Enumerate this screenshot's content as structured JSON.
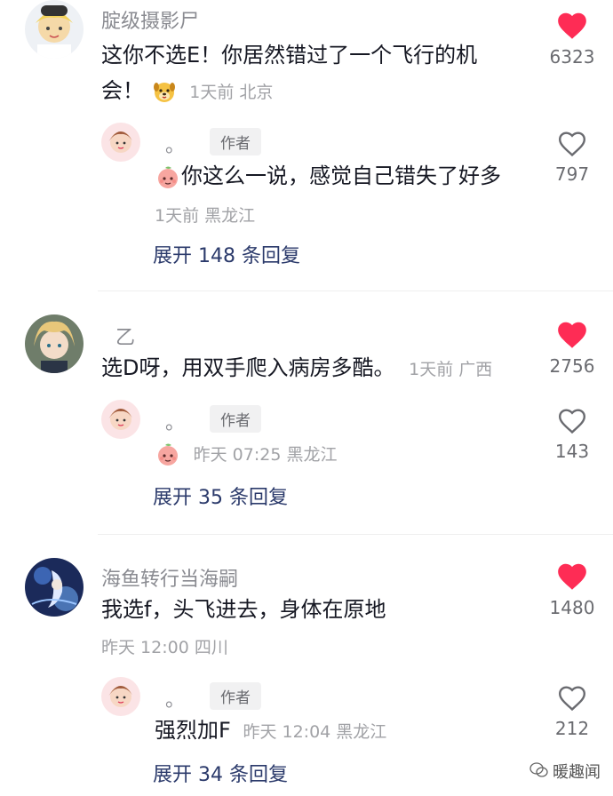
{
  "colors": {
    "like_red": "#fe2c55",
    "expand_blue": "#2b3a6b"
  },
  "comments": [
    {
      "username": "腚级摄影尸",
      "text_line1": "这你不选E！你居然错过了一个飞行的机",
      "text_line2": "会！",
      "meta": "1天前 北京",
      "likes": "6323",
      "liked": true,
      "reply": {
        "name": "。",
        "badge": "作者",
        "text": "你这么一说，感觉自己错失了好多",
        "meta": "1天前 黑龙江",
        "likes": "797",
        "liked": false
      },
      "expand": "展开 148 条回复"
    },
    {
      "username": "乙",
      "text": "选D呀，用双手爬入病房多酷。",
      "meta": "1天前 广西",
      "likes": "2756",
      "liked": true,
      "reply": {
        "name": "。",
        "badge": "作者",
        "meta": "昨天 07:25 黑龙江",
        "likes": "143",
        "liked": false
      },
      "expand": "展开 35 条回复"
    },
    {
      "username": "海鱼转行当海嗣",
      "text": "我选f，头飞进去，身体在原地",
      "meta": "昨天 12:00 四川",
      "likes": "1480",
      "liked": true,
      "reply": {
        "name": "。",
        "badge": "作者",
        "text": "强烈加F",
        "meta": "昨天 12:04 黑龙江",
        "likes": "212",
        "liked": false
      },
      "expand": "展开 34 条回复"
    }
  ],
  "watermark": "暖趣闻"
}
